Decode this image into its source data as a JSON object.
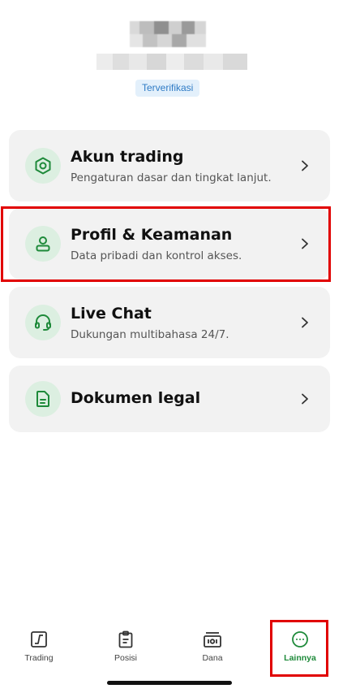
{
  "profile": {
    "verified_label": "Terverifikasi"
  },
  "menu": [
    {
      "title": "Akun trading",
      "subtitle": "Pengaturan dasar dan tingkat lanjut.",
      "icon": "hexagon-settings-icon"
    },
    {
      "title": "Profil & Keamanan",
      "subtitle": "Data pribadi dan kontrol akses.",
      "icon": "user-icon"
    },
    {
      "title": "Live Chat",
      "subtitle": "Dukungan multibahasa 24/7.",
      "icon": "headset-icon"
    },
    {
      "title": "Dokumen legal",
      "subtitle": "",
      "icon": "document-icon"
    }
  ],
  "bottom_nav": [
    {
      "label": "Trading",
      "icon": "chart-icon",
      "active": false
    },
    {
      "label": "Posisi",
      "icon": "clipboard-icon",
      "active": false
    },
    {
      "label": "Dana",
      "icon": "wallet-icon",
      "active": false
    },
    {
      "label": "Lainnya",
      "icon": "more-icon",
      "active": true
    }
  ],
  "colors": {
    "accent": "#1e8a3a",
    "icon_bg": "#dcefe1",
    "card_bg": "#f2f2f2",
    "highlight": "#e10000"
  }
}
